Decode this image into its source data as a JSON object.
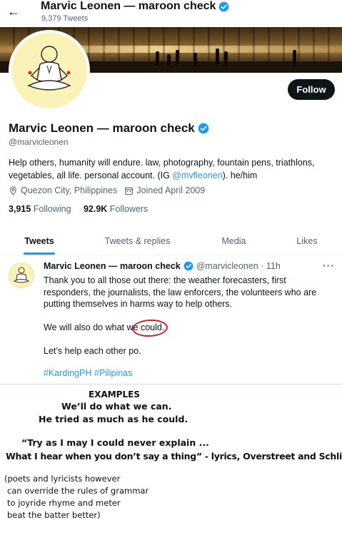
{
  "header": {
    "back_icon": "arrow-left-icon",
    "name": "Marvic Leonen — maroon check",
    "tweet_count": "9,379 Tweets"
  },
  "profile": {
    "follow_label": "Follow",
    "name": "Marvic Leonen — maroon check",
    "handle": "@marvicleonen",
    "bio_before": "Help others, humanity will endure. law, photography, fountain pens, triathlons, vegetables, all life. personal account. (IG ",
    "bio_mention": "@mvfleonen",
    "bio_after": "). he/him",
    "location": "Quezon City, Philippines",
    "joined": "Joined April 2009",
    "following_count": "3,915",
    "following_label": "Following",
    "followers_count": "92.9K",
    "followers_label": "Followers",
    "verified_color": "#1d9bf0"
  },
  "tabs": [
    "Tweets",
    "Tweets & replies",
    "Media",
    "Likes"
  ],
  "tweet": {
    "name": "Marvic Leonen — maroon check",
    "handle_time": "@marvicleonen · 11h",
    "more": "···",
    "para1": "Thank you to all those out there: the weather forecasters, first responders, the journalists, the law enforcers, the volunteers who are putting themselves in harms way to help others.",
    "para2": "We will also do what we could.",
    "para3": "Let’s help each other po.",
    "hashtags": "#KardingPH #Pilipinas"
  },
  "examples": {
    "title": "EXAMPLES",
    "line1": "We’ll do what we can.",
    "line2": "He tried as much as he could.",
    "quote1": "“Try as I may I could never explain ...",
    "quote2": "What I hear when you don’t say a thing” - lyrics, Overstreet and Schlitz",
    "note1": "(poets and lyricists however",
    "note2": "can override the rules of grammar",
    "note3": "to joyride rhyme and meter",
    "note4": "beat the batter better)"
  },
  "annotation_color": "#c8262b"
}
